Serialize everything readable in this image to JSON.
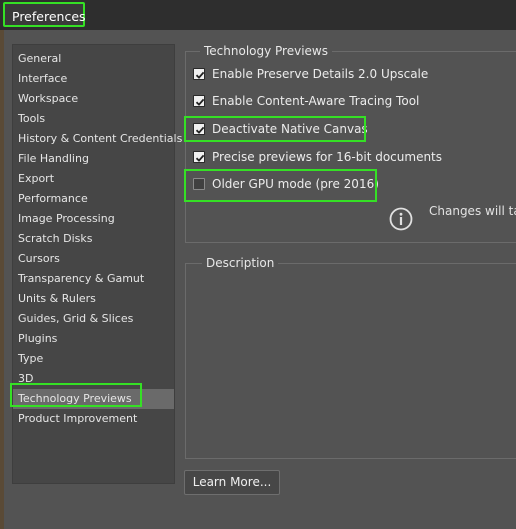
{
  "window": {
    "title": "Preferences"
  },
  "sidebar": {
    "items": [
      {
        "label": "General"
      },
      {
        "label": "Interface"
      },
      {
        "label": "Workspace"
      },
      {
        "label": "Tools"
      },
      {
        "label": "History & Content Credentials"
      },
      {
        "label": "File Handling"
      },
      {
        "label": "Export"
      },
      {
        "label": "Performance"
      },
      {
        "label": "Image Processing"
      },
      {
        "label": "Scratch Disks"
      },
      {
        "label": "Cursors"
      },
      {
        "label": "Transparency & Gamut"
      },
      {
        "label": "Units & Rulers"
      },
      {
        "label": "Guides, Grid & Slices"
      },
      {
        "label": "Plugins"
      },
      {
        "label": "Type"
      },
      {
        "label": "3D"
      },
      {
        "label": "Technology Previews",
        "selected": true
      },
      {
        "label": "Product Improvement"
      }
    ]
  },
  "tech_previews": {
    "group_title": "Technology Previews",
    "options": [
      {
        "label": "Enable Preserve Details 2.0 Upscale",
        "checked": true
      },
      {
        "label": "Enable Content-Aware Tracing Tool",
        "checked": true
      },
      {
        "label": "Deactivate Native Canvas",
        "checked": true
      },
      {
        "label": "Precise previews for 16-bit documents",
        "checked": true
      },
      {
        "label": "Older GPU mode (pre 2016)",
        "checked": false
      }
    ],
    "info_icon": "info-circle-icon",
    "info_text": "Changes will tak"
  },
  "description": {
    "group_title": "Description"
  },
  "learn_more": {
    "label": "Learn More..."
  },
  "colors": {
    "highlight": "#35e025",
    "background": "#535353",
    "sidebar_bg": "#464646",
    "selected_bg": "#6a6a6a"
  }
}
